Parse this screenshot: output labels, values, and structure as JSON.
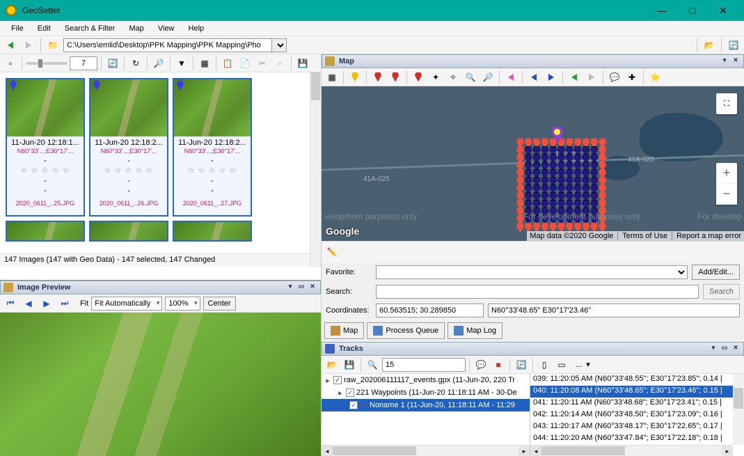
{
  "app": {
    "title": "GeoSetter"
  },
  "window_buttons": {
    "min": "—",
    "max": "□",
    "close": "✕"
  },
  "menu": [
    "File",
    "Edit",
    "Search & Filter",
    "Map",
    "View",
    "Help"
  ],
  "path": "C:\\Users\\emlid\\Desktop\\PPK Mapping\\PPK Mapping\\Pho",
  "spin_value": "7",
  "thumbs": [
    {
      "date": "11-Jun-20 12:18:1...",
      "coord": "N60°33'...;E30°17'...",
      "fname": "2020_0611_..25.JPG"
    },
    {
      "date": "11-Jun-20 12:18:2...",
      "coord": "N60°33'...;E30°17'...",
      "fname": "2020_0611_..26.JPG"
    },
    {
      "date": "11-Jun-20 12:18:2...",
      "coord": "N60°33'...;E30°17'...",
      "fname": "2020_0611_..27.JPG"
    }
  ],
  "thumb_dash": "-",
  "thumb_stars": "☆ ☆ ☆ ☆ ☆",
  "thumb_status": "147 Images (147 with Geo Data) - 147 selected, 147 Changed",
  "preview": {
    "title": "Image Preview",
    "fit_label": "Fit",
    "fit_value": "Fit Automatically",
    "zoom": "100%",
    "center": "Center",
    "nav": {
      "first": "⏮",
      "prev": "◀",
      "next": "▶",
      "last": "⏭"
    }
  },
  "map": {
    "title": "Map",
    "road_label": "41A-025",
    "dev_text1": "velopment purposes only",
    "dev_text2": "For development purposes only",
    "dev_text3": "For develop",
    "google": "Google",
    "attrib": [
      "Map data ©2020 Google",
      "Terms of Use",
      "Report a map error"
    ],
    "fullscreen": "⛶",
    "zoom_in": "+",
    "zoom_out": "−",
    "favorite_label": "Favorite:",
    "search_label": "Search:",
    "coords_label": "Coordinates:",
    "coords_dec": "60.563515; 30.289850",
    "coords_dms": "N60°33'48.65\" E30°17'23.46\"",
    "add_edit": "Add/Edit...",
    "search_btn": "Search",
    "tab_map": "Map",
    "tab_queue": "Process Queue",
    "tab_log": "Map Log"
  },
  "tracks": {
    "title": "Tracks",
    "spin": "15",
    "more": "...",
    "tree": {
      "file": "raw_202006111117_events.gpx (11-Jun-20, 220 Tr",
      "waypoints": "221 Waypoints (11-Jun-20 11:18:11 AM - 30-De",
      "noname": "Noname 1 (11-Jun-20, 11:18:11 AM - 11:29"
    },
    "list": [
      "039: 11:20:05 AM (N60°33'48.55\"; E30°17'23.85\"; 0.14 |",
      "040: 11:20:08 AM (N60°33'48.65\"; E30°17'23.46\"; 0.15 |",
      "041: 11:20:11 AM (N60°33'48.68\"; E30°17'23.41\"; 0.15 |",
      "042: 11:20:14 AM (N60°33'48.50\"; E30°17'23.09\"; 0.16 |",
      "043: 11:20:17 AM (N60°33'48.17\"; E30°17'22.65\"; 0.17 |",
      "044: 11:20:20 AM (N60°33'47.84\"; E30°17'22.18\"; 0.18 |"
    ],
    "selected_index": 1
  }
}
